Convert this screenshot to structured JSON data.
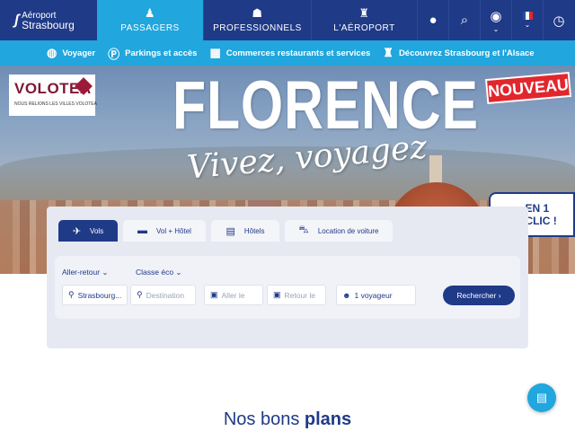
{
  "topnav": {
    "logo": {
      "line1": "Aéroport",
      "line2": "Strasbourg"
    },
    "tabs": [
      {
        "label": "PASSAGERS",
        "icon": "passenger-icon"
      },
      {
        "label": "PROFESSIONNELS",
        "icon": "professional-icon"
      },
      {
        "label": "L'AÉROPORT",
        "icon": "control-tower-icon"
      }
    ],
    "actions": [
      "user-icon",
      "search-icon",
      "eye-icon",
      "flag-fr-icon",
      "clock-icon"
    ]
  },
  "subnav": {
    "items": [
      {
        "label": "Voyager",
        "icon": "globe-plane-icon"
      },
      {
        "label": "Parkings et accès",
        "icon": "parking-icon"
      },
      {
        "label": "Commerces restaurants et services",
        "icon": "shop-icon"
      },
      {
        "label": "Découvrez Strasbourg et l'Alsace",
        "icon": "cathedral-icon"
      }
    ]
  },
  "hero": {
    "title": "FLORENCE",
    "subtitle": "Vivez, voyagez",
    "partner": {
      "name": "VOLOTEA",
      "tagline": "NOUS RELIONS LES VILLES VOLOTEA"
    },
    "badge": "NOUVEAU",
    "quick": {
      "line1": "EN 1",
      "line2": "CLIC !"
    }
  },
  "booking": {
    "tabs": [
      {
        "label": "Vols",
        "icon": "plane-icon",
        "active": true
      },
      {
        "label": "Vol + Hôtel",
        "icon": "bed-icon"
      },
      {
        "label": "Hôtels",
        "icon": "hotel-icon"
      },
      {
        "label": "Location de voiture",
        "icon": "car-icon"
      }
    ],
    "trip_type": "Aller-retour ⌄",
    "cabin": "Classe éco ⌄",
    "from": "Strasbourg...",
    "destination_placeholder": "Destination",
    "depart_placeholder": "Aller le",
    "return_placeholder": "Retour le",
    "passengers": "1 voyageur",
    "search": "Rechercher ›"
  },
  "deals": {
    "prefix": "Nos bons",
    "bold": "plans"
  },
  "colors": {
    "navy": "#1f3a87",
    "sky": "#21a6dd",
    "red": "#e2262d"
  }
}
